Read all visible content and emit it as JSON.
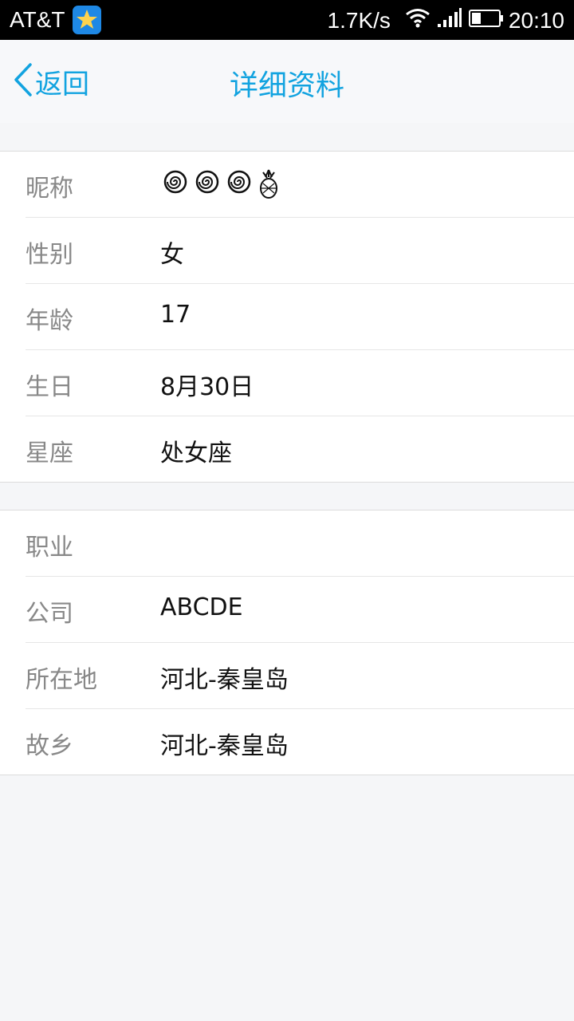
{
  "status_bar": {
    "carrier": "AT&T",
    "net_speed": "1.7K/s",
    "time": "20:10",
    "battery_level": 0.35
  },
  "nav": {
    "back_label": "返回",
    "title": "详细资料"
  },
  "profile": {
    "basic": [
      {
        "label": "昵称",
        "value": ""
      },
      {
        "label": "性别",
        "value": "女"
      },
      {
        "label": "年龄",
        "value": "17"
      },
      {
        "label": "生日",
        "value": "8月30日"
      },
      {
        "label": "星座",
        "value": "处女座"
      }
    ],
    "nickname_icons": [
      "spiral-icon",
      "spiral-icon",
      "spiral-icon",
      "pineapple-icon"
    ],
    "extra": [
      {
        "label": "职业",
        "value": ""
      },
      {
        "label": "公司",
        "value": "ABCDE"
      },
      {
        "label": "所在地",
        "value": "河北-秦皇岛"
      },
      {
        "label": "故乡",
        "value": "河北-秦皇岛"
      }
    ]
  },
  "colors": {
    "accent": "#12a3e0",
    "label": "#888888",
    "background": "#f5f6f8"
  }
}
